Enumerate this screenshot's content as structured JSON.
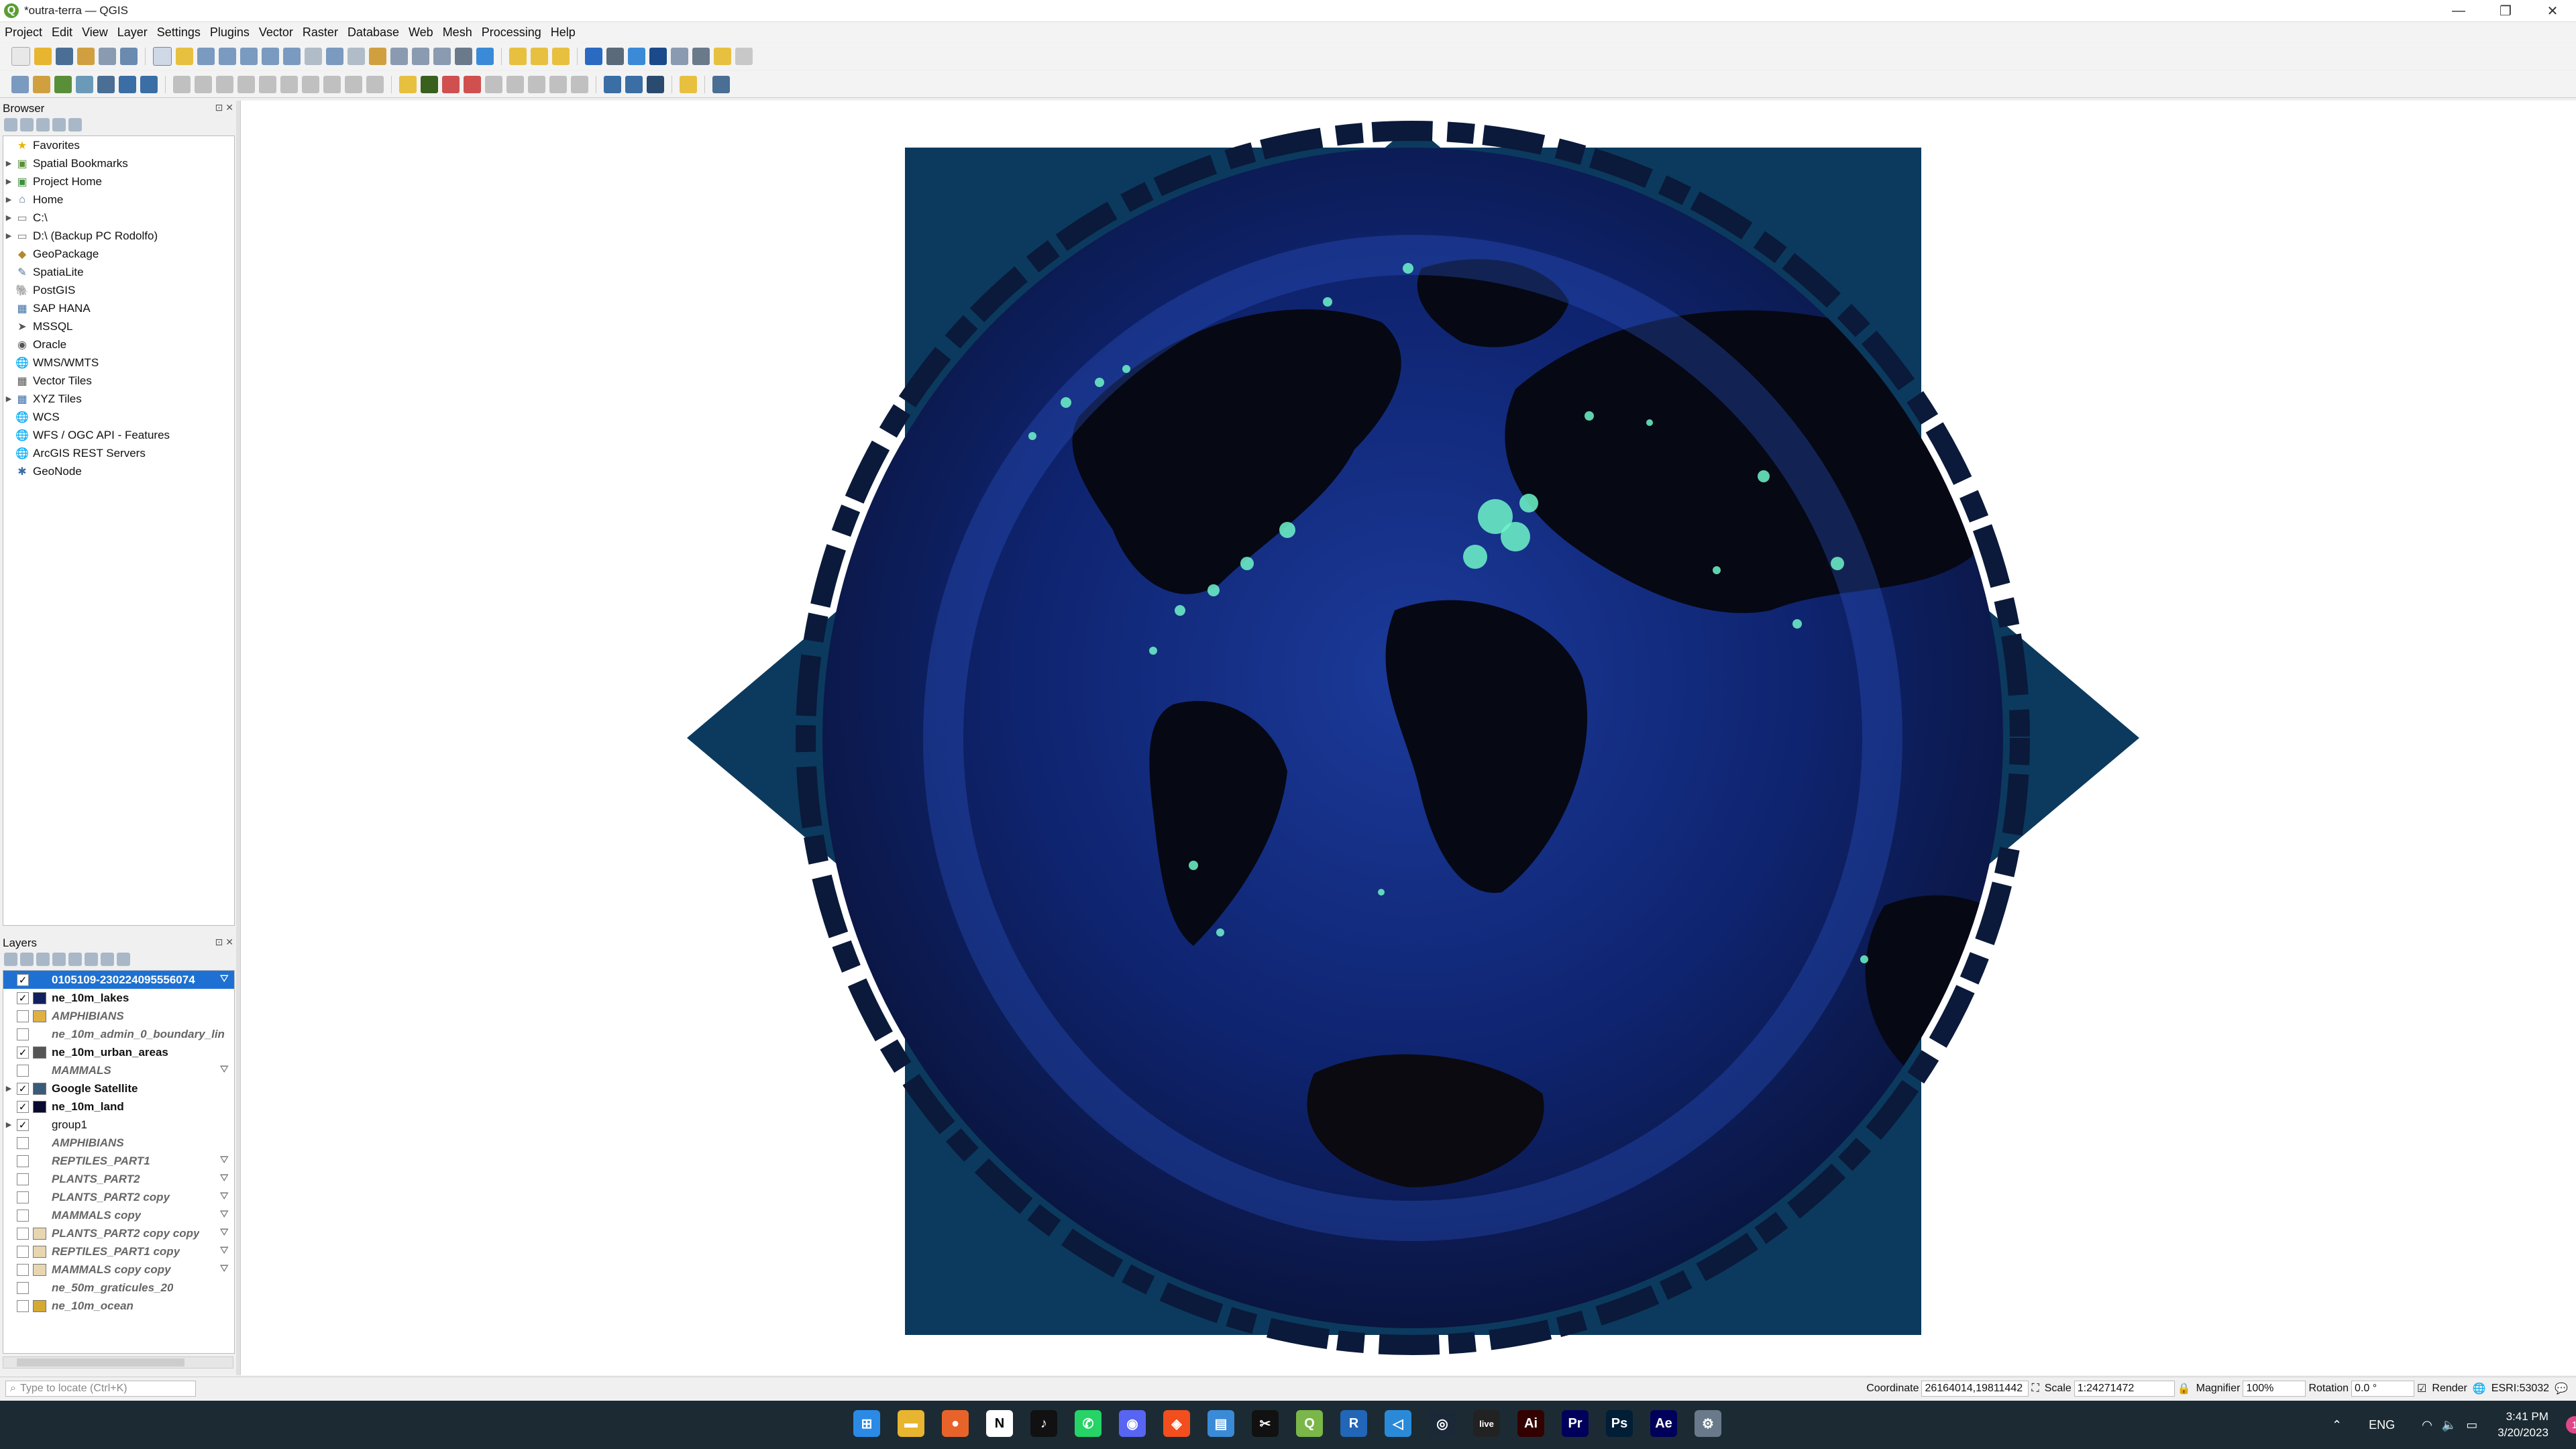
{
  "window": {
    "title": "*outra-terra — QGIS",
    "app_icon": "Q",
    "controls": {
      "minimize": "—",
      "maximize": "❐",
      "close": "✕"
    }
  },
  "menu": [
    "Project",
    "Edit",
    "View",
    "Layer",
    "Settings",
    "Plugins",
    "Vector",
    "Raster",
    "Database",
    "Web",
    "Mesh",
    "Processing",
    "Help"
  ],
  "browser": {
    "title": "Browser",
    "items": [
      {
        "label": "Favorites",
        "icon": "star-icon",
        "glyph": "★",
        "color": "#e8b400",
        "expand": false
      },
      {
        "label": "Spatial Bookmarks",
        "icon": "bookmark-icon",
        "glyph": "▣",
        "color": "#5a8f3a",
        "expand": true
      },
      {
        "label": "Project Home",
        "icon": "project-home-icon",
        "glyph": "▣",
        "color": "#3f8f3f",
        "expand": true
      },
      {
        "label": "Home",
        "icon": "home-icon",
        "glyph": "⌂",
        "color": "#4a6e94",
        "expand": true
      },
      {
        "label": "C:\\",
        "icon": "drive-icon",
        "glyph": "▭",
        "color": "#777777",
        "expand": true
      },
      {
        "label": "D:\\ (Backup PC Rodolfo)",
        "icon": "drive-icon",
        "glyph": "▭",
        "color": "#777777",
        "expand": true
      },
      {
        "label": "GeoPackage",
        "icon": "geopackage-icon",
        "glyph": "◆",
        "color": "#b08a2e",
        "expand": false
      },
      {
        "label": "SpatiaLite",
        "icon": "spatialite-icon",
        "glyph": "✎",
        "color": "#4a6e94",
        "expand": false
      },
      {
        "label": "PostGIS",
        "icon": "postgis-icon",
        "glyph": "🐘",
        "color": "#336791",
        "expand": false
      },
      {
        "label": "SAP HANA",
        "icon": "sap-hana-icon",
        "glyph": "▦",
        "color": "#3a6ea5",
        "expand": false
      },
      {
        "label": "MSSQL",
        "icon": "mssql-icon",
        "glyph": "➤",
        "color": "#555555",
        "expand": false
      },
      {
        "label": "Oracle",
        "icon": "oracle-icon",
        "glyph": "◉",
        "color": "#555555",
        "expand": false
      },
      {
        "label": "WMS/WMTS",
        "icon": "wms-icon",
        "glyph": "🌐",
        "color": "#3a6ea5",
        "expand": false
      },
      {
        "label": "Vector Tiles",
        "icon": "vector-tiles-icon",
        "glyph": "▦",
        "color": "#555555",
        "expand": false
      },
      {
        "label": "XYZ Tiles",
        "icon": "xyz-tiles-icon",
        "glyph": "▦",
        "color": "#3a6ea5",
        "expand": true
      },
      {
        "label": "WCS",
        "icon": "wcs-icon",
        "glyph": "🌐",
        "color": "#3a6ea5",
        "expand": false
      },
      {
        "label": "WFS / OGC API - Features",
        "icon": "wfs-icon",
        "glyph": "🌐",
        "color": "#3a6ea5",
        "expand": false
      },
      {
        "label": "ArcGIS REST Servers",
        "icon": "arcgis-icon",
        "glyph": "🌐",
        "color": "#3a6ea5",
        "expand": false
      },
      {
        "label": "GeoNode",
        "icon": "geonode-icon",
        "glyph": "✱",
        "color": "#3a6ea5",
        "expand": false
      }
    ]
  },
  "layers": {
    "title": "Layers",
    "items": [
      {
        "name": "0105109-230224095556074",
        "checked": true,
        "swatch": null,
        "style": "bold",
        "selected": true,
        "filter": true
      },
      {
        "name": "ne_10m_lakes",
        "checked": true,
        "swatch": "#11205e",
        "style": "bold",
        "filter": false
      },
      {
        "name": "AMPHIBIANS",
        "checked": false,
        "swatch": "#e0b040",
        "style": "italic",
        "filter": false
      },
      {
        "name": "ne_10m_admin_0_boundary_lin",
        "checked": false,
        "swatch": null,
        "style": "italic",
        "filter": false
      },
      {
        "name": "ne_10m_urban_areas",
        "checked": true,
        "swatch": "#555555",
        "style": "bold",
        "filter": false
      },
      {
        "name": "MAMMALS",
        "checked": false,
        "swatch": null,
        "style": "italic",
        "filter": true
      },
      {
        "name": "Google Satellite",
        "checked": true,
        "swatch": "#3a5a7a",
        "style": "bold",
        "filter": false,
        "expand": true
      },
      {
        "name": "ne_10m_land",
        "checked": true,
        "swatch": "#0a0a30",
        "style": "bold",
        "filter": false
      },
      {
        "name": "group1",
        "checked": true,
        "swatch": null,
        "style": "normal",
        "filter": false,
        "expand": true
      },
      {
        "name": "AMPHIBIANS",
        "checked": false,
        "swatch": null,
        "style": "italic",
        "filter": false
      },
      {
        "name": "REPTILES_PART1",
        "checked": false,
        "swatch": null,
        "style": "italic",
        "filter": true
      },
      {
        "name": "PLANTS_PART2",
        "checked": false,
        "swatch": null,
        "style": "italic",
        "filter": true
      },
      {
        "name": "PLANTS_PART2 copy",
        "checked": false,
        "swatch": null,
        "style": "italic",
        "filter": true
      },
      {
        "name": "MAMMALS copy",
        "checked": false,
        "swatch": null,
        "style": "italic",
        "filter": true
      },
      {
        "name": "PLANTS_PART2 copy copy",
        "checked": false,
        "swatch": "#e8d6b0",
        "style": "italic",
        "filter": true
      },
      {
        "name": "REPTILES_PART1 copy",
        "checked": false,
        "swatch": "#e8d6b0",
        "style": "italic",
        "filter": true
      },
      {
        "name": "MAMMALS copy copy",
        "checked": false,
        "swatch": "#e8d6b0",
        "style": "italic",
        "filter": true
      },
      {
        "name": "ne_50m_graticules_20",
        "checked": false,
        "swatch": null,
        "style": "italic",
        "filter": false
      },
      {
        "name": "ne_10m_ocean",
        "checked": false,
        "swatch": "#d4aa30",
        "style": "italic",
        "filter": false
      }
    ]
  },
  "status": {
    "locate_placeholder": "Type to locate (Ctrl+K)",
    "coordinate_label": "Coordinate",
    "coordinate_value": "26164014,19811442",
    "scale_label": "Scale",
    "scale_value": "1:24271472",
    "magnifier_label": "Magnifier",
    "magnifier_value": "100%",
    "rotation_label": "Rotation",
    "rotation_value": "0.0 °",
    "render_label": "Render",
    "crs": "ESRI:53032"
  },
  "taskbar": {
    "apps": [
      {
        "name": "windows-start-icon",
        "color": "#2b8ae6",
        "glyph": "⊞"
      },
      {
        "name": "file-explorer-icon",
        "color": "#e8b530",
        "glyph": "▬"
      },
      {
        "name": "firefox-icon",
        "color": "#e8632a",
        "glyph": "●"
      },
      {
        "name": "notion-icon",
        "color": "#ffffff",
        "glyph": "N"
      },
      {
        "name": "tiktok-icon",
        "color": "#111111",
        "glyph": "♪"
      },
      {
        "name": "whatsapp-icon",
        "color": "#25d366",
        "glyph": "✆"
      },
      {
        "name": "discord-icon",
        "color": "#5865f2",
        "glyph": "◉"
      },
      {
        "name": "figma-icon",
        "color": "#f24e1e",
        "glyph": "◈"
      },
      {
        "name": "notepad-icon",
        "color": "#3a8ad8",
        "glyph": "▤"
      },
      {
        "name": "capcut-icon",
        "color": "#111111",
        "glyph": "✂"
      },
      {
        "name": "qgis-icon",
        "color": "#7ab648",
        "glyph": "Q"
      },
      {
        "name": "r-icon",
        "color": "#2266b8",
        "glyph": "R"
      },
      {
        "name": "vscode-icon",
        "color": "#2a8ad8",
        "glyph": "◁"
      },
      {
        "name": "steam-icon",
        "color": "#1b2838",
        "glyph": "◎"
      },
      {
        "name": "live-icon",
        "color": "#222222",
        "glyph": "live"
      },
      {
        "name": "illustrator-icon",
        "color": "#330000",
        "glyph": "Ai"
      },
      {
        "name": "premiere-icon",
        "color": "#00005b",
        "glyph": "Pr"
      },
      {
        "name": "photoshop-icon",
        "color": "#001e36",
        "glyph": "Ps"
      },
      {
        "name": "after-effects-icon",
        "color": "#00005b",
        "glyph": "Ae"
      },
      {
        "name": "settings-icon",
        "color": "#6a7a8a",
        "glyph": "⚙"
      }
    ],
    "language": "ENG",
    "time": "3:41 PM",
    "date": "3/20/2023",
    "notification_count": "1"
  }
}
